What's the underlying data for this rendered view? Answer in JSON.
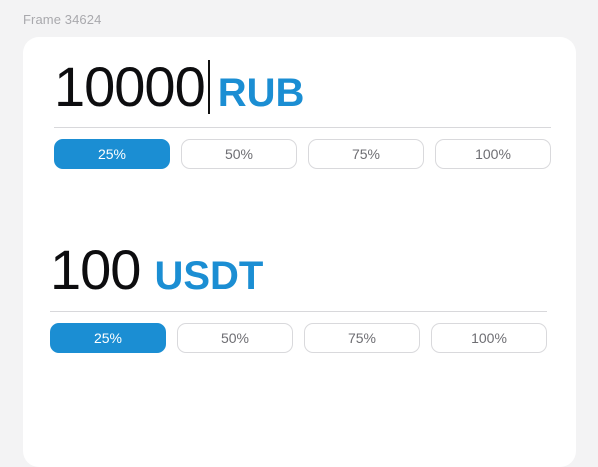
{
  "frame_label": "Frame 34624",
  "from": {
    "amount": "10000",
    "currency": "RUB",
    "percent_options": [
      "25%",
      "50%",
      "75%",
      "100%"
    ],
    "selected_index": 0
  },
  "to": {
    "amount": "100",
    "currency": "USDT",
    "percent_options": [
      "25%",
      "50%",
      "75%",
      "100%"
    ],
    "selected_index": 0
  },
  "colors": {
    "accent": "#1b8ed3",
    "background": "#f3f3f4",
    "card": "#ffffff",
    "text": "#0d0d0f",
    "muted_text": "#6e6e73"
  }
}
